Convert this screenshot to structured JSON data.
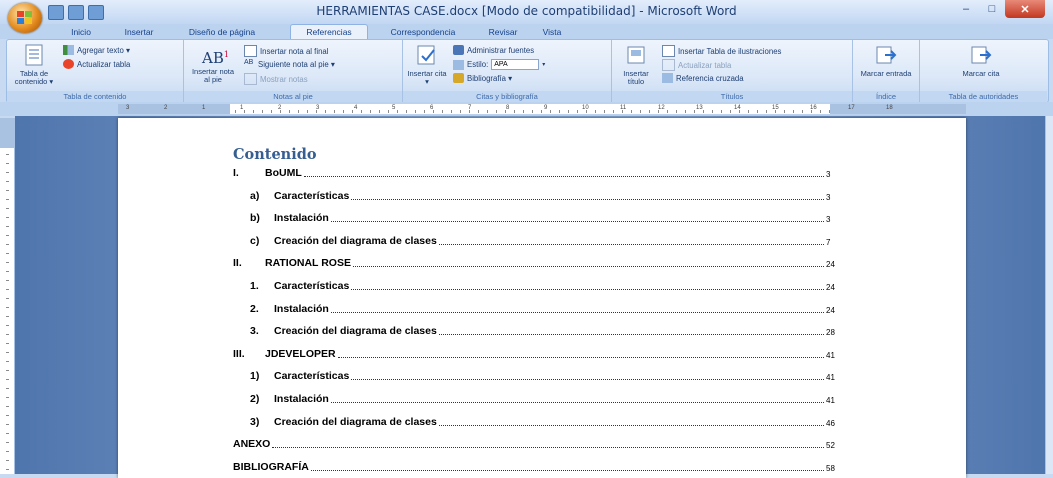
{
  "window": {
    "title": "HERRAMIENTAS CASE.docx [Modo de compatibilidad] - Microsoft Word"
  },
  "tabs": [
    {
      "label": "Inicio",
      "active": false
    },
    {
      "label": "Insertar",
      "active": false
    },
    {
      "label": "Diseño de página",
      "active": false
    },
    {
      "label": "Referencias",
      "active": true
    },
    {
      "label": "Correspondencia",
      "active": false
    },
    {
      "label": "Revisar",
      "active": false
    },
    {
      "label": "Vista",
      "active": false
    }
  ],
  "ribbon": {
    "tabla_contenido": {
      "big_button": "Tabla de contenido ▾",
      "agregar_texto": "Agregar texto ▾",
      "actualizar_tabla": "Actualizar tabla",
      "group_label": "Tabla de contenido"
    },
    "notas_pie": {
      "big_button": "Insertar nota al pie",
      "insertar_nota_final": "Insertar nota al final",
      "siguiente_nota": "Siguiente nota al pie ▾",
      "mostrar_notas": "Mostrar notas",
      "group_label": "Notas al pie"
    },
    "citas": {
      "big_button": "Insertar cita ▾",
      "administrar_fuentes": "Administrar fuentes",
      "estilo_label": "Estilo:",
      "estilo_value": "APA",
      "bibliografia": "Bibliografía ▾",
      "group_label": "Citas y bibliografía"
    },
    "titulos": {
      "big_button": "Insertar título",
      "insertar_tabla_ilustraciones": "Insertar Tabla de ilustraciones",
      "actualizar_tabla": "Actualizar tabla",
      "referencia_cruzada": "Referencia cruzada",
      "group_label": "Títulos"
    },
    "indice": {
      "big_button": "Marcar entrada",
      "group_label": "Índice"
    },
    "autoridades": {
      "big_button": "Marcar cita",
      "group_label": "Tabla de autoridades"
    }
  },
  "ruler": {
    "numbers": [
      "3",
      "2",
      "1",
      "1",
      "2",
      "3",
      "4",
      "5",
      "6",
      "7",
      "8",
      "9",
      "10",
      "11",
      "12",
      "13",
      "14",
      "15",
      "16",
      "17",
      "18"
    ]
  },
  "document": {
    "toc_heading": "Contenido",
    "entries": [
      {
        "num": "I.",
        "text": "BoUML",
        "page": "3",
        "level": 1
      },
      {
        "num": "a)",
        "text": "Características",
        "page": "3",
        "level": 2
      },
      {
        "num": "b)",
        "text": "Instalación",
        "page": "3",
        "level": 2
      },
      {
        "num": "c)",
        "text": "Creación del diagrama de clases",
        "page": "7",
        "level": 2
      },
      {
        "num": "II.",
        "text": "RATIONAL ROSE",
        "page": "24",
        "level": 1
      },
      {
        "num": "1.",
        "text": "Características",
        "page": "24",
        "level": 2
      },
      {
        "num": "2.",
        "text": "Instalación",
        "page": "24",
        "level": 2
      },
      {
        "num": "3.",
        "text": "Creación del diagrama de clases",
        "page": "28",
        "level": 2
      },
      {
        "num": "III.",
        "text": "JDEVELOPER",
        "page": "41",
        "level": 1
      },
      {
        "num": "1)",
        "text": "Características",
        "page": "41",
        "level": 2
      },
      {
        "num": "2)",
        "text": "Instalación",
        "page": "41",
        "level": 2
      },
      {
        "num": "3)",
        "text": "Creación del diagrama de clases",
        "page": "46",
        "level": 2
      },
      {
        "num": "",
        "text": "ANEXO",
        "page": "52",
        "level": 0
      },
      {
        "num": "",
        "text": "BIBLIOGRAFÍA",
        "page": "58",
        "level": 0
      }
    ]
  }
}
